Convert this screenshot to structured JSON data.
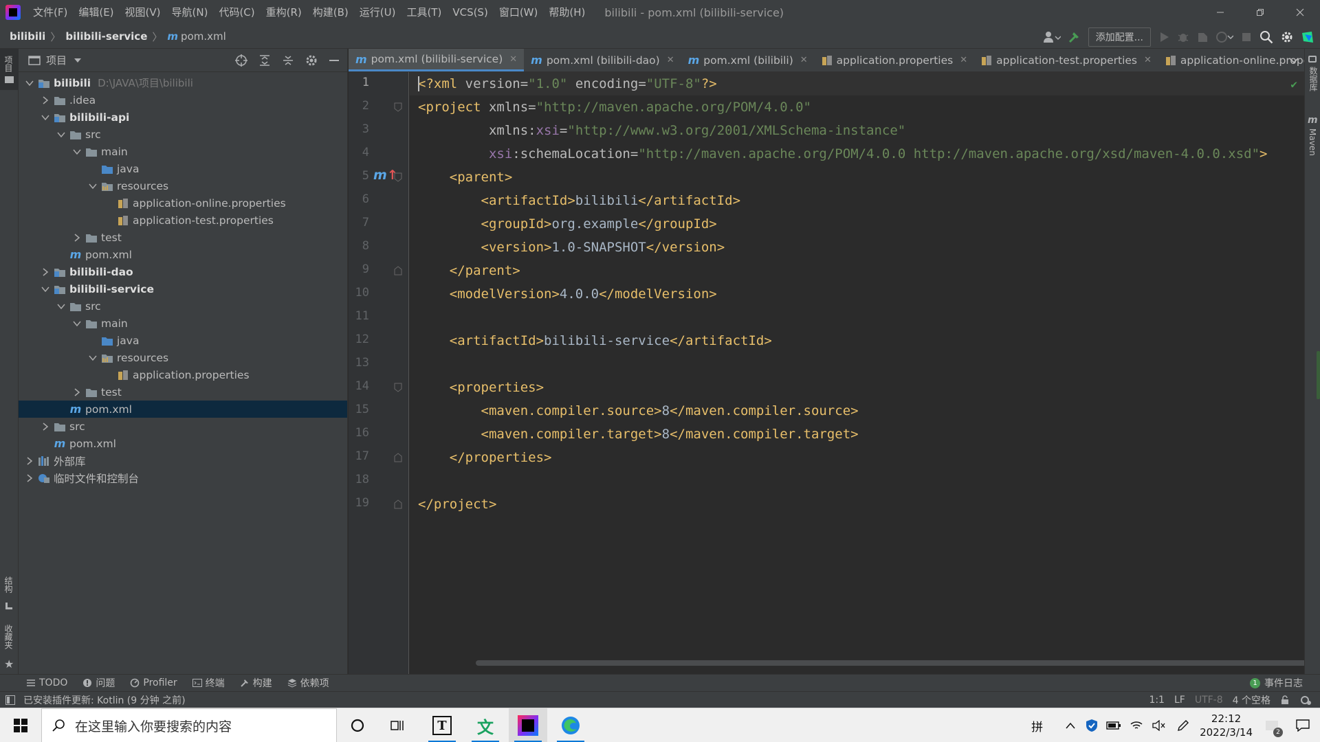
{
  "titlebar": {
    "menus": [
      "文件(F)",
      "编辑(E)",
      "视图(V)",
      "导航(N)",
      "代码(C)",
      "重构(R)",
      "构建(B)",
      "运行(U)",
      "工具(T)",
      "VCS(S)",
      "窗口(W)",
      "帮助(H)"
    ],
    "window_title": "bilibili - pom.xml (bilibili-service)"
  },
  "navbar": {
    "crumbs": [
      "bilibili",
      "bilibili-service",
      "pom.xml"
    ],
    "config_button": "添加配置..."
  },
  "project_panel": {
    "title": "项目",
    "tree": [
      {
        "label": "bilibili",
        "path": "D:\\JAVA\\项目\\bilibili",
        "bold": true,
        "icon": "module-folder-icon",
        "expanded": true
      },
      {
        "label": ".idea",
        "icon": "folder-icon",
        "expanded": false
      },
      {
        "label": "bilibili-api",
        "bold": true,
        "icon": "module-folder-icon",
        "expanded": true
      },
      {
        "label": "src",
        "icon": "folder-icon",
        "expanded": true
      },
      {
        "label": "main",
        "icon": "folder-icon",
        "expanded": true
      },
      {
        "label": "java",
        "icon": "source-folder-icon"
      },
      {
        "label": "resources",
        "icon": "resources-folder-icon",
        "expanded": true
      },
      {
        "label": "application-online.properties",
        "icon": "properties-file-icon"
      },
      {
        "label": "application-test.properties",
        "icon": "properties-file-icon"
      },
      {
        "label": "test",
        "icon": "folder-icon",
        "expanded": false
      },
      {
        "label": "pom.xml",
        "icon": "maven-file-icon"
      },
      {
        "label": "bilibili-dao",
        "bold": true,
        "icon": "module-folder-icon",
        "expanded": false
      },
      {
        "label": "bilibili-service",
        "bold": true,
        "icon": "module-folder-icon",
        "expanded": true
      },
      {
        "label": "src",
        "icon": "folder-icon",
        "expanded": true
      },
      {
        "label": "main",
        "icon": "folder-icon",
        "expanded": true
      },
      {
        "label": "java",
        "icon": "source-folder-icon"
      },
      {
        "label": "resources",
        "icon": "resources-folder-icon",
        "expanded": true
      },
      {
        "label": "application.properties",
        "icon": "properties-file-icon"
      },
      {
        "label": "test",
        "icon": "folder-icon",
        "expanded": false
      },
      {
        "label": "pom.xml",
        "icon": "maven-file-icon",
        "selected": true
      },
      {
        "label": "src",
        "icon": "folder-icon",
        "expanded": false
      },
      {
        "label": "pom.xml",
        "icon": "maven-file-icon"
      },
      {
        "label": "外部库",
        "icon": "library-icon",
        "expanded": false
      },
      {
        "label": "临时文件和控制台",
        "icon": "scratch-icon",
        "expanded": false
      }
    ]
  },
  "editor": {
    "tabs": [
      {
        "label": "pom.xml (bilibili-service)",
        "icon": "maven-file-icon",
        "active": true
      },
      {
        "label": "pom.xml (bilibili-dao)",
        "icon": "maven-file-icon"
      },
      {
        "label": "pom.xml (bilibili)",
        "icon": "maven-file-icon"
      },
      {
        "label": "application.properties",
        "icon": "properties-file-icon"
      },
      {
        "label": "application-test.properties",
        "icon": "properties-file-icon"
      },
      {
        "label": "application-online.proper",
        "icon": "properties-file-icon"
      }
    ],
    "line_numbers": [
      "1",
      "2",
      "3",
      "4",
      "5",
      "6",
      "7",
      "8",
      "9",
      "10",
      "11",
      "12",
      "13",
      "14",
      "15",
      "16",
      "17",
      "18",
      "19"
    ],
    "current_line": 1,
    "code": {
      "l1_a": "<?xml ",
      "l1_b": "version",
      "l1_c": "=",
      "l1_d": "\"1.0\"",
      "l1_e": " encoding",
      "l1_f": "=",
      "l1_g": "\"UTF-8\"",
      "l1_h": "?>",
      "l2_a": "<project ",
      "l2_b": "xmlns",
      "l2_c": "=",
      "l2_d": "\"http://maven.apache.org/POM/4.0.0\"",
      "l3_a": "         xmlns:",
      "l3_b": "xsi",
      "l3_c": "=",
      "l3_d": "\"http://www.w3.org/2001/XMLSchema-instance\"",
      "l4_a": "         ",
      "l4_b": "xsi",
      "l4_c": ":schemaLocation",
      "l4_d": "=",
      "l4_e": "\"http://maven.apache.org/POM/4.0.0 http://maven.apache.org/xsd/maven-4.0.0.xsd\"",
      "l4_f": ">",
      "l5": "    <parent>",
      "l6_a": "        <artifactId>",
      "l6_b": "bilibili",
      "l6_c": "</artifactId>",
      "l7_a": "        <groupId>",
      "l7_b": "org.example",
      "l7_c": "</groupId>",
      "l8_a": "        <version>",
      "l8_b": "1.0-SNAPSHOT",
      "l8_c": "</version>",
      "l9": "    </parent>",
      "l10_a": "    <modelVersion>",
      "l10_b": "4.0.0",
      "l10_c": "</modelVersion>",
      "l12_a": "    <artifactId>",
      "l12_b": "bilibili-service",
      "l12_c": "</artifactId>",
      "l14": "    <properties>",
      "l15_a": "        <maven.compiler.source>",
      "l15_b": "8",
      "l15_c": "</maven.compiler.source>",
      "l16_a": "        <maven.compiler.target>",
      "l16_b": "8",
      "l16_c": "</maven.compiler.target>",
      "l17": "    </properties>",
      "l19": "</project>"
    }
  },
  "left_strip": {
    "project_label": "项目",
    "structure_label": "结构",
    "favorites_label": "收藏夹"
  },
  "right_strip": {
    "database_label": "数据库",
    "maven_label": "Maven"
  },
  "bottom_bar": {
    "items": [
      "TODO",
      "问题",
      "Profiler",
      "终端",
      "构建",
      "依赖项"
    ],
    "event_log": "事件日志",
    "event_count": "1"
  },
  "status_bar": {
    "message": "已安装插件更新: Kotlin (9 分钟 之前)",
    "position": "1:1",
    "line_sep": "LF",
    "encoding": "UTF-8",
    "indent": "4 个空格"
  },
  "taskbar": {
    "search_placeholder": "在这里输入你要搜索的内容",
    "ime": "拼",
    "time": "22:12",
    "date": "2022/3/14",
    "notification_count": "2"
  }
}
